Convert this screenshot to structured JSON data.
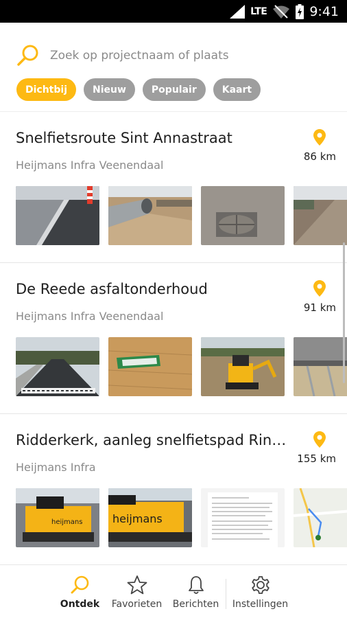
{
  "status_bar": {
    "network": "LTE",
    "time": "9:41"
  },
  "search": {
    "placeholder": "Zoek op projectnaam of plaats"
  },
  "filters": [
    {
      "label": "Dichtbij",
      "active": true
    },
    {
      "label": "Nieuw",
      "active": false
    },
    {
      "label": "Populair",
      "active": false
    },
    {
      "label": "Kaart",
      "active": false
    }
  ],
  "projects": [
    {
      "title": "Snelfietsroute Sint Annastraat",
      "company": "Heijmans Infra Veenendaal",
      "distance": "86 km",
      "photos": [
        "road-curb-photo",
        "pipes-sand-photo",
        "drain-cover-photo",
        "roadbed-photo"
      ]
    },
    {
      "title": "De Reede asfaltonderhoud",
      "company": "Heijmans Infra Veenendaal",
      "distance": "91 km",
      "photos": [
        "new-asphalt-road-photo",
        "wood-sign-photo",
        "excavator-photo",
        "steel-formwork-photo"
      ]
    },
    {
      "title": "Ridderkerk, aanleg snelfietspad Ring…",
      "company": "Heijmans Infra",
      "distance": "155 km",
      "photos": [
        "paver-machine-photo",
        "heijmans-paver-photo",
        "document-photo",
        "map-photo"
      ]
    }
  ],
  "paver_brand": "heijmans",
  "bottom_nav": [
    {
      "label": "Ontdek",
      "icon": "search-icon",
      "active": true
    },
    {
      "label": "Favorieten",
      "icon": "star-icon",
      "active": false
    },
    {
      "label": "Berichten",
      "icon": "bell-icon",
      "active": false
    },
    {
      "label": "Instellingen",
      "icon": "gear-icon",
      "active": false
    }
  ],
  "colors": {
    "accent": "#fdb913",
    "chip_inactive": "#9e9e9e"
  }
}
